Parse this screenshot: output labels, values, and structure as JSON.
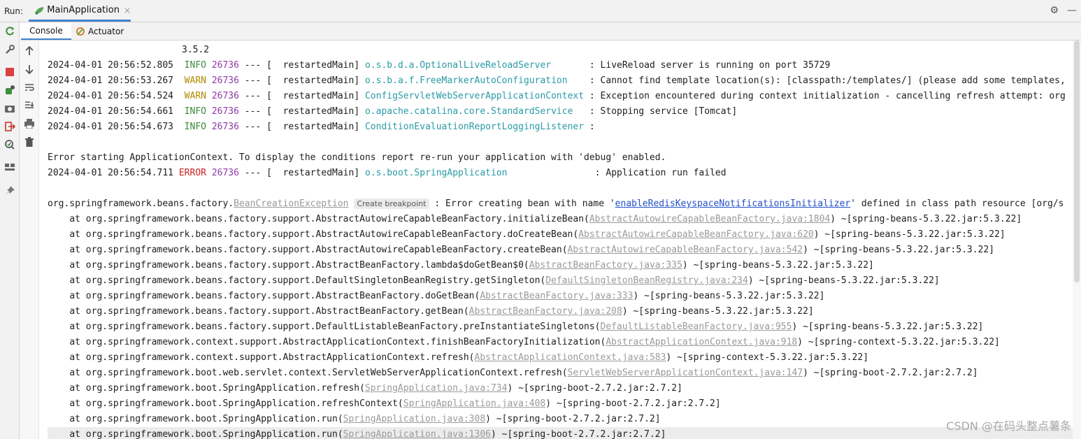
{
  "run_bar": {
    "label": "Run:",
    "tab_title": "MainApplication",
    "tab_close": "×",
    "actions": [
      "gear-icon",
      "minimize-icon"
    ]
  },
  "subtabs": {
    "console_label": "Console",
    "actuator_label": "Actuator"
  },
  "left_toolbar_icons": [
    "rerun-icon",
    "wrench-icon",
    "stop-icon",
    "debug-settings-icon",
    "camera-icon",
    "exit-icon",
    "coverage-icon",
    "layout-icon",
    "pin-icon"
  ],
  "gutter_icons": [
    "arrow-up-icon",
    "arrow-down-icon",
    "soft-wrap-icon",
    "scroll-to-end-icon",
    "print-icon",
    "trash-icon"
  ],
  "console": {
    "banner_version": "3.5.2",
    "logs": [
      {
        "ts": "2024-04-01 20:56:52.805",
        "level": "INFO",
        "pid": "26736",
        "thread": "restartedMain",
        "logger": "o.s.b.d.a.OptionalLiveReloadServer",
        "pad": "      ",
        "msg": "LiveReload server is running on port 35729"
      },
      {
        "ts": "2024-04-01 20:56:53.267",
        "level": "WARN",
        "pid": "26736",
        "thread": "restartedMain",
        "logger": "o.s.b.a.f.FreeMarkerAutoConfiguration",
        "pad": "   ",
        "msg": "Cannot find template location(s): [classpath:/templates/] (please add some templates,"
      },
      {
        "ts": "2024-04-01 20:56:54.524",
        "level": "WARN",
        "pid": "26736",
        "thread": "restartedMain",
        "logger": "ConfigServletWebServerApplicationContext",
        "pad": "",
        "msg": "Exception encountered during context initialization - cancelling refresh attempt: org"
      },
      {
        "ts": "2024-04-01 20:56:54.661",
        "level": "INFO",
        "pid": "26736",
        "thread": "restartedMain",
        "logger": "o.apache.catalina.core.StandardService",
        "pad": "  ",
        "msg": "Stopping service [Tomcat]"
      },
      {
        "ts": "2024-04-01 20:56:54.673",
        "level": "INFO",
        "pid": "26736",
        "thread": "restartedMain",
        "logger": "ConditionEvaluationReportLoggingListener",
        "pad": "",
        "msg": ""
      }
    ],
    "error_start_text": "Error starting ApplicationContext. To display the conditions report re-run your application with 'debug' enabled.",
    "error_log": {
      "ts": "2024-04-01 20:56:54.711",
      "level": "ERROR",
      "pid": "26736",
      "thread": "restartedMain",
      "logger": "o.s.boot.SpringApplication",
      "pad": "               ",
      "msg": "Application run failed"
    },
    "exception": {
      "prefix": "org.springframework.beans.factory.",
      "class_link": "BeanCreationException",
      "hint": "Create breakpoint",
      "text_before_bean": " : Error creating bean with name '",
      "bean_link": "enableRedisKeyspaceNotificationsInitializer",
      "text_after_bean": "' defined in class path resource [org/s"
    },
    "stack": [
      {
        "call": "at org.springframework.beans.factory.support.AbstractAutowireCapableBeanFactory.initializeBean(",
        "src": "AbstractAutowireCapableBeanFactory.java:1804",
        "jar": ") ~[spring-beans-5.3.22.jar:5.3.22]"
      },
      {
        "call": "at org.springframework.beans.factory.support.AbstractAutowireCapableBeanFactory.doCreateBean(",
        "src": "AbstractAutowireCapableBeanFactory.java:620",
        "jar": ") ~[spring-beans-5.3.22.jar:5.3.22]"
      },
      {
        "call": "at org.springframework.beans.factory.support.AbstractAutowireCapableBeanFactory.createBean(",
        "src": "AbstractAutowireCapableBeanFactory.java:542",
        "jar": ") ~[spring-beans-5.3.22.jar:5.3.22]"
      },
      {
        "call": "at org.springframework.beans.factory.support.AbstractBeanFactory.lambda$doGetBean$0(",
        "src": "AbstractBeanFactory.java:335",
        "jar": ") ~[spring-beans-5.3.22.jar:5.3.22]"
      },
      {
        "call": "at org.springframework.beans.factory.support.DefaultSingletonBeanRegistry.getSingleton(",
        "src": "DefaultSingletonBeanRegistry.java:234",
        "jar": ") ~[spring-beans-5.3.22.jar:5.3.22]"
      },
      {
        "call": "at org.springframework.beans.factory.support.AbstractBeanFactory.doGetBean(",
        "src": "AbstractBeanFactory.java:333",
        "jar": ") ~[spring-beans-5.3.22.jar:5.3.22]"
      },
      {
        "call": "at org.springframework.beans.factory.support.AbstractBeanFactory.getBean(",
        "src": "AbstractBeanFactory.java:208",
        "jar": ") ~[spring-beans-5.3.22.jar:5.3.22]"
      },
      {
        "call": "at org.springframework.beans.factory.support.DefaultListableBeanFactory.preInstantiateSingletons(",
        "src": "DefaultListableBeanFactory.java:955",
        "jar": ") ~[spring-beans-5.3.22.jar:5.3.22]"
      },
      {
        "call": "at org.springframework.context.support.AbstractApplicationContext.finishBeanFactoryInitialization(",
        "src": "AbstractApplicationContext.java:918",
        "jar": ") ~[spring-context-5.3.22.jar:5.3.22]"
      },
      {
        "call": "at org.springframework.context.support.AbstractApplicationContext.refresh(",
        "src": "AbstractApplicationContext.java:583",
        "jar": ") ~[spring-context-5.3.22.jar:5.3.22]"
      },
      {
        "call": "at org.springframework.boot.web.servlet.context.ServletWebServerApplicationContext.refresh(",
        "src": "ServletWebServerApplicationContext.java:147",
        "jar": ") ~[spring-boot-2.7.2.jar:2.7.2]"
      },
      {
        "call": "at org.springframework.boot.SpringApplication.refresh(",
        "src": "SpringApplication.java:734",
        "jar": ") ~[spring-boot-2.7.2.jar:2.7.2]"
      },
      {
        "call": "at org.springframework.boot.SpringApplication.refreshContext(",
        "src": "SpringApplication.java:408",
        "jar": ") ~[spring-boot-2.7.2.jar:2.7.2]"
      },
      {
        "call": "at org.springframework.boot.SpringApplication.run(",
        "src": "SpringApplication.java:308",
        "jar": ") ~[spring-boot-2.7.2.jar:2.7.2]"
      },
      {
        "call": "at org.springframework.boot.SpringApplication.run(",
        "src": "SpringApplication.java:1306",
        "jar": ") ~[spring-boot-2.7.2.jar:2.7.2]"
      }
    ]
  },
  "watermark": "CSDN @在码头整点薯条",
  "colors": {
    "info": "#3d8a3a",
    "warn": "#b08a00",
    "error": "#cc2222",
    "pid": "#8e3aa7",
    "logger": "#2a9aa6",
    "link": "#2450c8",
    "accent": "#4083c9"
  }
}
